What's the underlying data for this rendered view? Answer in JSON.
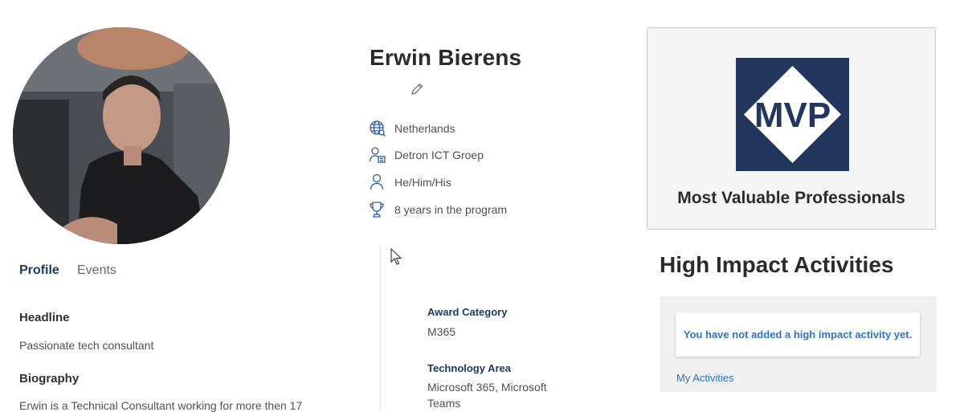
{
  "profile": {
    "name": "Erwin Bierens",
    "details": {
      "country": "Netherlands",
      "company": "Detron ICT Groep",
      "pronouns": "He/Him/His",
      "program_years": "8 years in the program"
    }
  },
  "tabs": {
    "profile": "Profile",
    "events": "Events"
  },
  "about": {
    "headline_label": "Headline",
    "headline_text": "Passionate tech consultant",
    "biography_label": "Biography",
    "biography_text": "Erwin is a Technical Consultant working for more then 17"
  },
  "award": {
    "category_label": "Award Category",
    "category_value": "M365",
    "technology_label": "Technology Area",
    "technology_value": "Microsoft 365, Microsoft Teams"
  },
  "mvp_card": {
    "logo_text": "MVP",
    "title": "Most Valuable Professionals"
  },
  "high_impact": {
    "title": "High Impact Activities",
    "empty_message": "You have not added a high impact activity yet.",
    "link": "My Activities"
  },
  "colors": {
    "brand_navy": "#22365e",
    "link_blue": "#2f73c0",
    "icon_blue": "#2a5ca8"
  }
}
